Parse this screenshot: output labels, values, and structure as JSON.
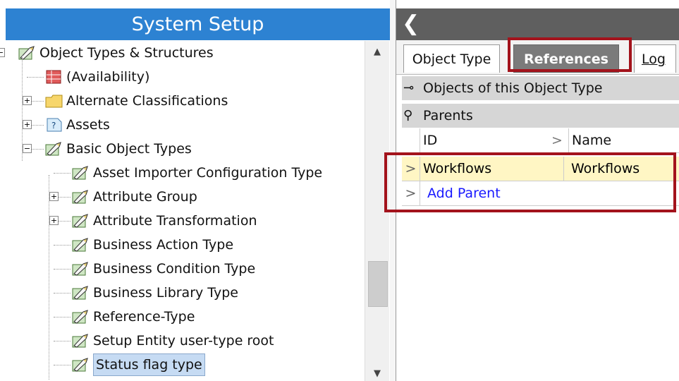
{
  "left_panel": {
    "title": "System Setup",
    "tree": [
      {
        "label": "Object Types & Structures",
        "icon": "object-type-icon",
        "expander": "−"
      },
      {
        "label": "(Availability)",
        "icon": "table-icon",
        "expander": ""
      },
      {
        "label": "Alternate Classifications",
        "icon": "folder-icon",
        "expander": "+"
      },
      {
        "label": "Assets",
        "icon": "asset-icon",
        "expander": "+"
      },
      {
        "label": "Basic Object Types",
        "icon": "object-type-icon",
        "expander": "−"
      },
      {
        "label": "Asset Importer Configuration Type",
        "icon": "object-type-icon",
        "expander": ""
      },
      {
        "label": "Attribute Group",
        "icon": "object-type-icon",
        "expander": "+"
      },
      {
        "label": "Attribute Transformation",
        "icon": "object-type-icon",
        "expander": "+"
      },
      {
        "label": "Business Action Type",
        "icon": "object-type-icon",
        "expander": ""
      },
      {
        "label": "Business Condition Type",
        "icon": "object-type-icon",
        "expander": ""
      },
      {
        "label": "Business Library Type",
        "icon": "object-type-icon",
        "expander": ""
      },
      {
        "label": "Reference-Type",
        "icon": "object-type-icon",
        "expander": ""
      },
      {
        "label": "Setup Entity user-type root",
        "icon": "object-type-icon",
        "expander": ""
      },
      {
        "label": "Status flag type",
        "icon": "object-type-icon",
        "expander": "",
        "selected": true
      }
    ],
    "scroll_up": "▲",
    "scroll_down": "▼"
  },
  "right_panel": {
    "back_glyph": "❮",
    "tabs": [
      {
        "label": "Object Type"
      },
      {
        "label": "References",
        "active": true
      },
      {
        "label": "Log"
      }
    ],
    "sections": {
      "objects_label": "Objects of this  Object Type",
      "objects_glyph": "⊸",
      "parents_label": "Parents",
      "parents_glyph": "⚲"
    },
    "grid": {
      "headers": [
        "ID",
        "Name"
      ],
      "header_sort_glyph": ">",
      "rows": [
        {
          "id": "Workflows",
          "name": "Workflows",
          "marker": ">"
        },
        {
          "id": "Add Parent",
          "name": "",
          "marker": ">",
          "link": true
        }
      ]
    }
  },
  "colors": {
    "title_bar": "#2d82d2",
    "right_header": "#5f5f5f",
    "highlight": "#a3131c",
    "selected_row": "#fff6c4",
    "link": "#1a1aff"
  }
}
